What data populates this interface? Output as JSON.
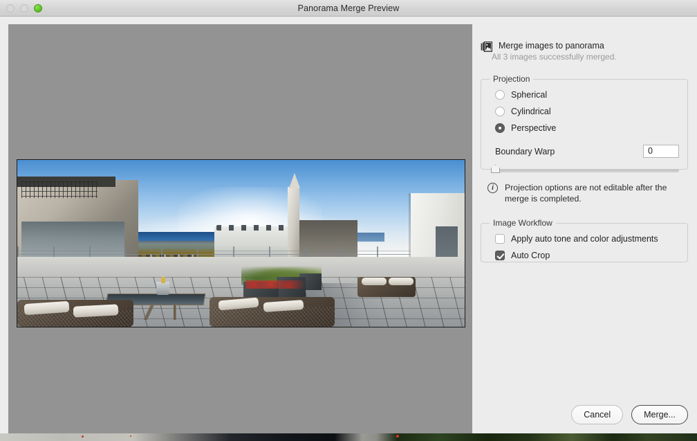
{
  "window": {
    "title": "Panorama Merge Preview",
    "traffic_lights": [
      {
        "name": "close",
        "state": "disabled"
      },
      {
        "name": "minimize",
        "state": "disabled"
      },
      {
        "name": "zoom",
        "state": "enabled",
        "color": "#5fc226"
      }
    ]
  },
  "preview": {
    "name": "panorama-preview",
    "background_color": "#939393",
    "image_description": "Rooftop terrace panorama with sea, church spire and outdoor furniture"
  },
  "sidebar": {
    "header": {
      "icon": "stacked-images-icon",
      "title": "Merge images to panorama",
      "status": "All 3 images successfully merged."
    },
    "projection": {
      "legend": "Projection",
      "options": [
        {
          "label": "Spherical",
          "selected": false
        },
        {
          "label": "Cylindrical",
          "selected": false
        },
        {
          "label": "Perspective",
          "selected": true
        }
      ],
      "boundary_warp": {
        "label": "Boundary Warp",
        "value": "0",
        "slider_position_percent": 0
      },
      "info": {
        "icon": "info-icon",
        "glyph": "i",
        "text": "Projection options are not editable after the merge is completed."
      }
    },
    "image_workflow": {
      "legend": "Image Workflow",
      "options": [
        {
          "label": "Apply auto tone and color adjustments",
          "checked": false
        },
        {
          "label": "Auto Crop",
          "checked": true
        }
      ]
    }
  },
  "footer": {
    "cancel_label": "Cancel",
    "merge_label": "Merge..."
  }
}
